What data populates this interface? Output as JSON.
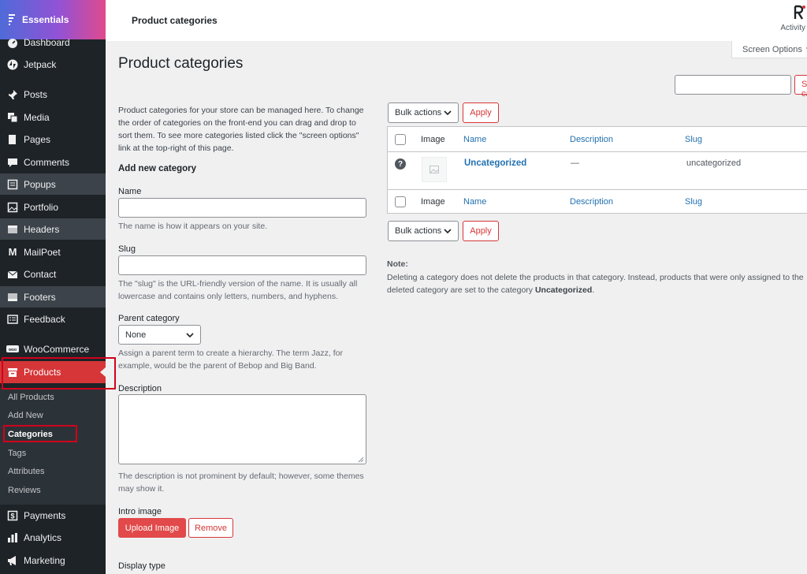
{
  "sidebar": {
    "brand_label": "Essentials",
    "items": [
      {
        "label": "Dashboard",
        "icon": "dashboard-icon"
      },
      {
        "label": "Jetpack",
        "icon": "jetpack-icon"
      },
      {
        "label": "Posts",
        "icon": "pin-icon"
      },
      {
        "label": "Media",
        "icon": "media-icon"
      },
      {
        "label": "Pages",
        "icon": "pages-icon"
      },
      {
        "label": "Comments",
        "icon": "comment-icon"
      },
      {
        "label": "Popups",
        "icon": "popups-icon"
      },
      {
        "label": "Portfolio",
        "icon": "portfolio-icon"
      },
      {
        "label": "Headers",
        "icon": "headers-icon"
      },
      {
        "label": "MailPoet",
        "icon": "mailpoet-icon"
      },
      {
        "label": "Contact",
        "icon": "mail-icon"
      },
      {
        "label": "Footers",
        "icon": "footers-icon"
      },
      {
        "label": "Feedback",
        "icon": "feedback-icon"
      },
      {
        "label": "WooCommerce",
        "icon": "woocommerce-icon"
      },
      {
        "label": "Products",
        "icon": "archive-icon"
      },
      {
        "label": "Payments",
        "icon": "dollar-icon"
      },
      {
        "label": "Analytics",
        "icon": "bar-chart-icon"
      },
      {
        "label": "Marketing",
        "icon": "megaphone-icon"
      }
    ],
    "submenu": [
      "All Products",
      "Add New",
      "Categories",
      "Tags",
      "Attributes",
      "Reviews"
    ]
  },
  "topbar": {
    "title": "Product categories",
    "activity_label": "Activity"
  },
  "screen_options_label": "Screen Options",
  "page_title": "Product categories",
  "search_button_label": "Search categories",
  "form": {
    "intro": "Product categories for your store can be managed here. To change the order of categories on the front-end you can drag and drop to sort them. To see more categories listed click the \"screen options\" link at the top-right of this page.",
    "heading": "Add new category",
    "name_label": "Name",
    "name_help": "The name is how it appears on your site.",
    "slug_label": "Slug",
    "slug_help": "The \"slug\" is the URL-friendly version of the name. It is usually all lowercase and contains only letters, numbers, and hyphens.",
    "parent_label": "Parent category",
    "parent_value": "None",
    "parent_help": "Assign a parent term to create a hierarchy. The term Jazz, for example, would be the parent of Bebop and Big Band.",
    "description_label": "Description",
    "description_help": "The description is not prominent by default; however, some themes may show it.",
    "intro_image_label": "Intro image",
    "upload_label": "Upload Image",
    "remove_label": "Remove",
    "display_type_label": "Display type"
  },
  "table": {
    "bulk_actions": "Bulk actions",
    "apply": "Apply",
    "columns": {
      "image": "Image",
      "name": "Name",
      "description": "Description",
      "slug": "Slug"
    },
    "rows": [
      {
        "name": "Uncategorized",
        "description": "—",
        "slug": "uncategorized"
      }
    ]
  },
  "note": {
    "title": "Note:",
    "text_before": "Deleting a category does not delete the products in that category. Instead, products that were only assigned to the deleted category are set to the category ",
    "text_bold": "Uncategorized",
    "text_after": "."
  },
  "colors": {
    "accent_red": "#d63638",
    "sidebar_bg": "#1d2327",
    "link_blue": "#2271b1"
  }
}
